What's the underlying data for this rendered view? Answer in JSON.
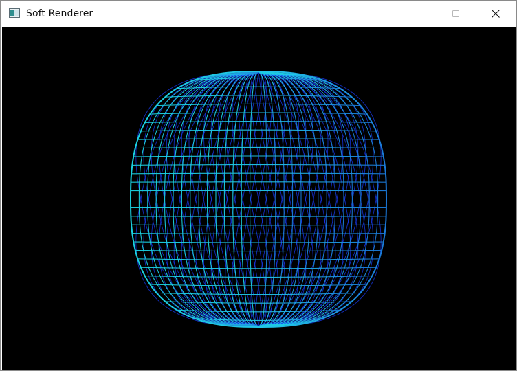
{
  "window": {
    "title": "Soft Renderer"
  },
  "icons": {
    "app": "app-window-icon",
    "minimize": "minimize-icon",
    "maximize": "maximize-icon",
    "close": "close-icon"
  },
  "colors": {
    "viewport_background": "#000000",
    "wire_cyan": "#1ad0e0",
    "wire_blue": "#1a3cff",
    "wire_edge_blue": "#1a78d8"
  }
}
